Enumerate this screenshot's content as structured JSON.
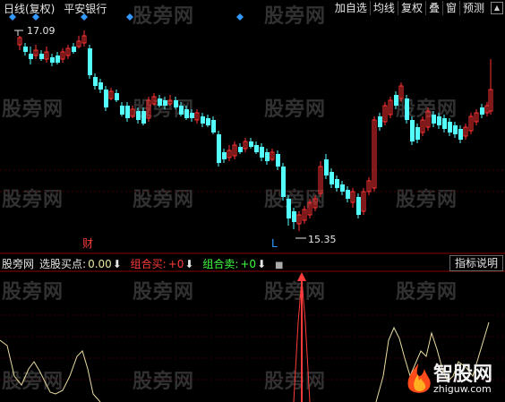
{
  "header": {
    "period_label": "日线(复权)",
    "stock_name": "平安银行"
  },
  "toolbar": {
    "items": [
      "加自选",
      "均线",
      "复权",
      "叠",
      "窗",
      "预测"
    ]
  },
  "price_chart": {
    "high_label": "17.09",
    "low_label": "15.35",
    "cai_marker": "财",
    "low_marker": "L",
    "colors": {
      "up": "#ff3232",
      "down": "#54ffff",
      "axis": "#8b0000",
      "diamond": "#3399ff"
    }
  },
  "indicator": {
    "name": "股旁网",
    "xuangu_label": "选股买点:",
    "xuangu_value": "0.00",
    "zuhe_buy_label": "组合买:",
    "zuhe_buy_value": "+0",
    "zuhe_sell_label": "组合卖:",
    "zuhe_sell_value": "+0",
    "legend_button": "指标说明",
    "colors": {
      "xuangu": "#e8e8a0",
      "buy": "#ff3c3c",
      "sell": "#40ff40",
      "line": "#e8dca0"
    }
  },
  "watermark": "股旁网",
  "logo": {
    "text": "智股网",
    "url": "zhiguw.com"
  }
}
